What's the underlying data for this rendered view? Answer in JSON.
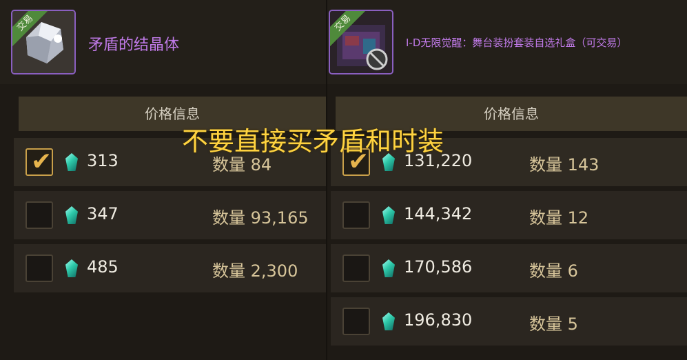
{
  "left_item": {
    "name": "矛盾的结晶体",
    "trade_tag": "交易",
    "icon": "crystal-icon",
    "price_header": "价格信息",
    "listings": [
      {
        "price": "313",
        "qty_label": "数量",
        "qty": "84",
        "selected": true
      },
      {
        "price": "347",
        "qty_label": "数量",
        "qty": "93,165",
        "selected": false
      },
      {
        "price": "485",
        "qty_label": "数量",
        "qty": "2,300",
        "selected": false
      }
    ]
  },
  "right_item": {
    "name": "I-D无限觉醒：舞台装扮套装自选礼盒（可交易）",
    "trade_tag": "交易",
    "icon": "gift-box-icon",
    "price_header": "价格信息",
    "listings": [
      {
        "price": "131,220",
        "qty_label": "数量",
        "qty": "143",
        "selected": true
      },
      {
        "price": "144,342",
        "qty_label": "数量",
        "qty": "12",
        "selected": false
      },
      {
        "price": "170,586",
        "qty_label": "数量",
        "qty": "6",
        "selected": false
      },
      {
        "price": "196,830",
        "qty_label": "数量",
        "qty": "5",
        "selected": false
      }
    ]
  },
  "overlay_text": "不要直接买矛盾和时装",
  "colors": {
    "item_name": "#c07ae8",
    "overlay": "#ffd340",
    "check": "#e6b44d",
    "gem": "#2ec9a9"
  }
}
